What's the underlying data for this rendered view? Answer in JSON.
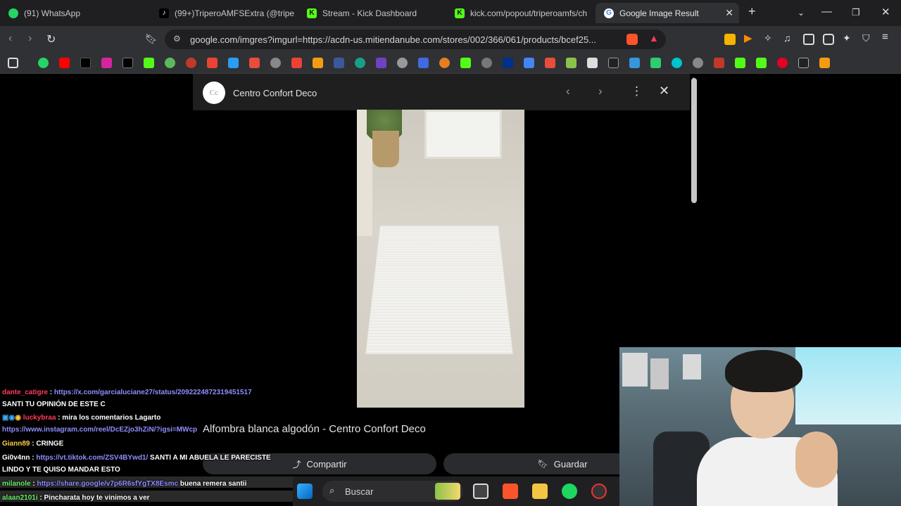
{
  "browser": {
    "tabs": [
      {
        "title": "(91) WhatsApp",
        "color": "#25d366",
        "glyph": "",
        "active": false
      },
      {
        "title": "(99+)TriperoAMFSExtra (@triperc",
        "color": "#ffffff",
        "glyph": "♪",
        "active": false
      },
      {
        "title": "Stream - Kick Dashboard",
        "color": "#53fc18",
        "glyph": "K",
        "active": false
      },
      {
        "title": "kick.com/popout/triperoamfs/ch",
        "color": "#53fc18",
        "glyph": "K",
        "active": false
      },
      {
        "title": "Google Image Result",
        "color": "#4285f4",
        "glyph": "G",
        "active": true
      }
    ],
    "new_tab_label": "+",
    "address": "google.com/imgres?imgurl=https://acdn-us.mitiendanube.com/stores/002/366/061/products/bcef25..."
  },
  "viewer": {
    "site_name": "Centro Confort Deco",
    "site_logo_text": "Cc",
    "caption": "Alfombra blanca algodón - Centro Confort Deco",
    "share_label": "Compartir",
    "save_label": "Guardar"
  },
  "chat": [
    {
      "user": "dante_catigre",
      "user_color": "u-red",
      "sep": " : ",
      "link": "https://x.com/garcialuciane27/status/2092224872319451517",
      "text": ""
    },
    {
      "user": "",
      "user_color": "u-white",
      "sep": "",
      "link": "",
      "text": "SANTI TU OPINIÓN DE ESTE C"
    },
    {
      "user": "luckybraa",
      "user_color": "u-red",
      "sep": " : ",
      "link": "",
      "text": "mira los comentarios Lagarto"
    },
    {
      "user": "",
      "user_color": "u-white",
      "sep": "",
      "link": "https://www.instagram.com/reel/DcEZjo3hZiN/?igsi=MWcp",
      "text": ""
    },
    {
      "user": "Giann89",
      "user_color": "u-gold",
      "sep": " : ",
      "link": "",
      "text": "CRINGE"
    },
    {
      "user": "Gi0v4nn",
      "user_color": "u-white",
      "sep": " : ",
      "link": "https://vt.tiktok.com/ZSV4BYwd1/",
      "text": " SANTI A MI ABUELA LE PARECISTE"
    },
    {
      "user": "",
      "user_color": "u-white",
      "sep": "",
      "link": "",
      "text": "LINDO Y TE QUISO MANDAR ESTO"
    },
    {
      "user": "milanole",
      "user_color": "u-green",
      "sep": " : ",
      "link": "https://share.google/v7p6R6sfYgTX8Esmc",
      "text": " buena remera santii"
    },
    {
      "user": "alaan2101i",
      "user_color": "u-green",
      "sep": " : ",
      "link": "",
      "text": "Pincharata hoy te vinimos a ver"
    }
  ],
  "taskbar": {
    "search_placeholder": "Buscar"
  }
}
